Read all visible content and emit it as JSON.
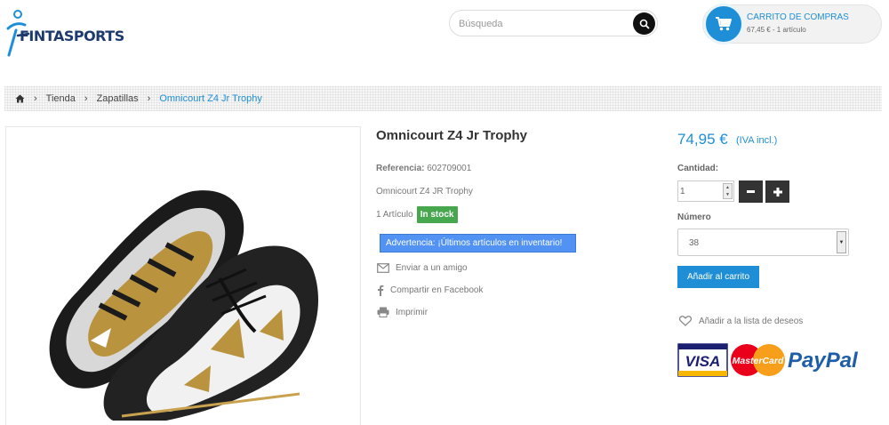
{
  "header": {
    "logo_text": "FINTASPORTS",
    "search_placeholder": "Búsqueda",
    "cart_title": "CARRITO DE COMPRAS",
    "cart_summary": "67,45 € - 1 artículo"
  },
  "breadcrumb": {
    "items": [
      "Tienda",
      "Zapatillas"
    ],
    "current": "Omnicourt Z4 Jr Trophy"
  },
  "product": {
    "title": "Omnicourt Z4 Jr Trophy",
    "reference_label": "Referencia:",
    "reference_value": "602709001",
    "short_description": "Omnicourt Z4 JR Trophy",
    "quantity_text": "1 Artículo",
    "stock_badge": "In stock",
    "warning": "Advertencia: ¡Últimos artículos en inventario!",
    "actions": {
      "send_friend": "Enviar a un amigo",
      "share_facebook": "Compartir en Facebook",
      "print": "Imprimir"
    }
  },
  "purchase": {
    "price": "74,95 €",
    "tax_note": "(IVA incl.)",
    "quantity_label": "Cantidad:",
    "quantity_value": "1",
    "size_label": "Número",
    "size_value": "38",
    "add_to_cart": "Añadir al carrito",
    "wishlist": "Añadir a la lista de deseos"
  },
  "payment_logos": {
    "visa": "VISA",
    "mastercard": "MasterCard",
    "paypal": "PayPal"
  },
  "colors": {
    "accent": "#1e8fd6",
    "stock_green": "#46a74e",
    "warning_blue": "#5192f3",
    "dark_button": "#333333"
  }
}
